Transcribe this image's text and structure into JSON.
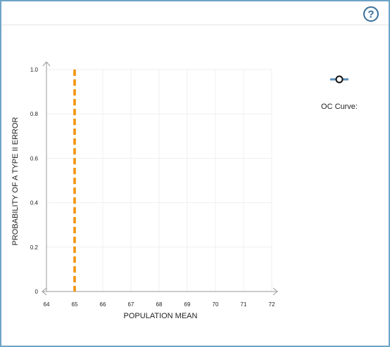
{
  "help_icon": "question-mark-icon",
  "chart_data": {
    "type": "line",
    "xlabel": "POPULATION MEAN",
    "ylabel": "PROBABILITY OF A TYPE II ERROR",
    "xlim": [
      64,
      72
    ],
    "ylim": [
      0,
      1.0
    ],
    "x_ticks": [
      "64",
      "65",
      "66",
      "67",
      "68",
      "69",
      "70",
      "71",
      "72"
    ],
    "y_ticks": [
      "0",
      "0.2",
      "0.4",
      "0.6",
      "0.8",
      "1.0"
    ],
    "grid": true,
    "series": [
      {
        "name": "OC Curve:",
        "x": [],
        "y": [],
        "color": "#5b8db8"
      }
    ],
    "reference_line": {
      "x": 65,
      "style": "dashed",
      "color": "#f39200"
    },
    "legend_placement": "right"
  }
}
